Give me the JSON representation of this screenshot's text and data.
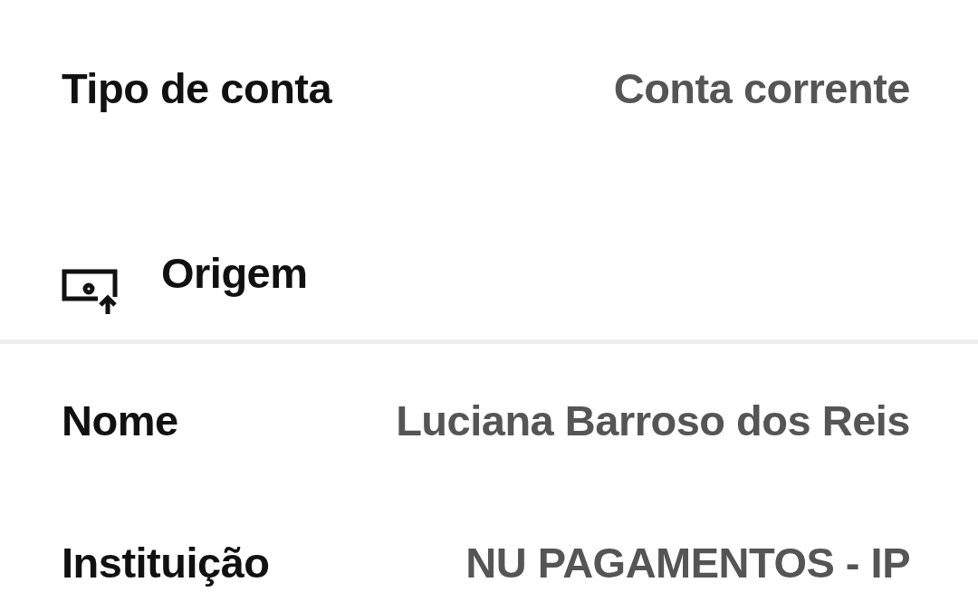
{
  "account_type": {
    "label": "Tipo de conta",
    "value": "Conta corrente"
  },
  "origin_section": {
    "title": "Origem",
    "rows": [
      {
        "label": "Nome",
        "value": "Luciana Barroso dos Reis"
      },
      {
        "label": "Instituição",
        "value": "NU PAGAMENTOS - IP"
      }
    ]
  }
}
